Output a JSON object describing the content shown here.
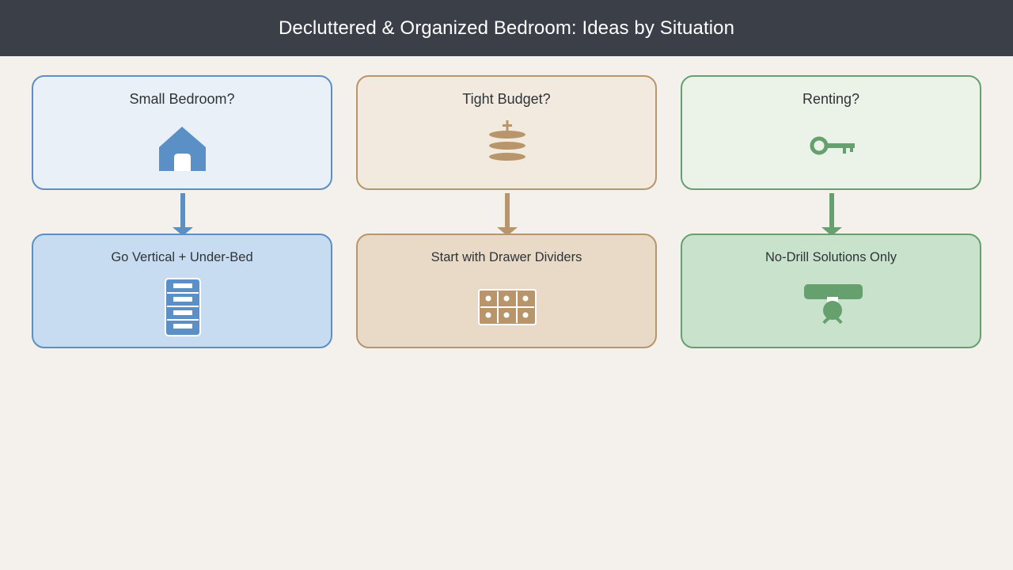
{
  "header": {
    "title": "Decluttered & Organized Bedroom: Ideas by Situation"
  },
  "columns": [
    {
      "question": "Small Bedroom?",
      "question_icon": "house-icon",
      "solution": "Go Vertical + Under-Bed",
      "solution_icon": "vertical-shelf-icon",
      "accent": "#5a90c6"
    },
    {
      "question": "Tight Budget?",
      "question_icon": "coin-stack-icon",
      "solution": "Start with Drawer Dividers",
      "solution_icon": "drawer-dividers-icon",
      "accent": "#b8956a"
    },
    {
      "question": "Renting?",
      "question_icon": "key-icon",
      "solution": "No-Drill Solutions Only",
      "solution_icon": "adhesive-hook-icon",
      "accent": "#66a06e"
    }
  ]
}
